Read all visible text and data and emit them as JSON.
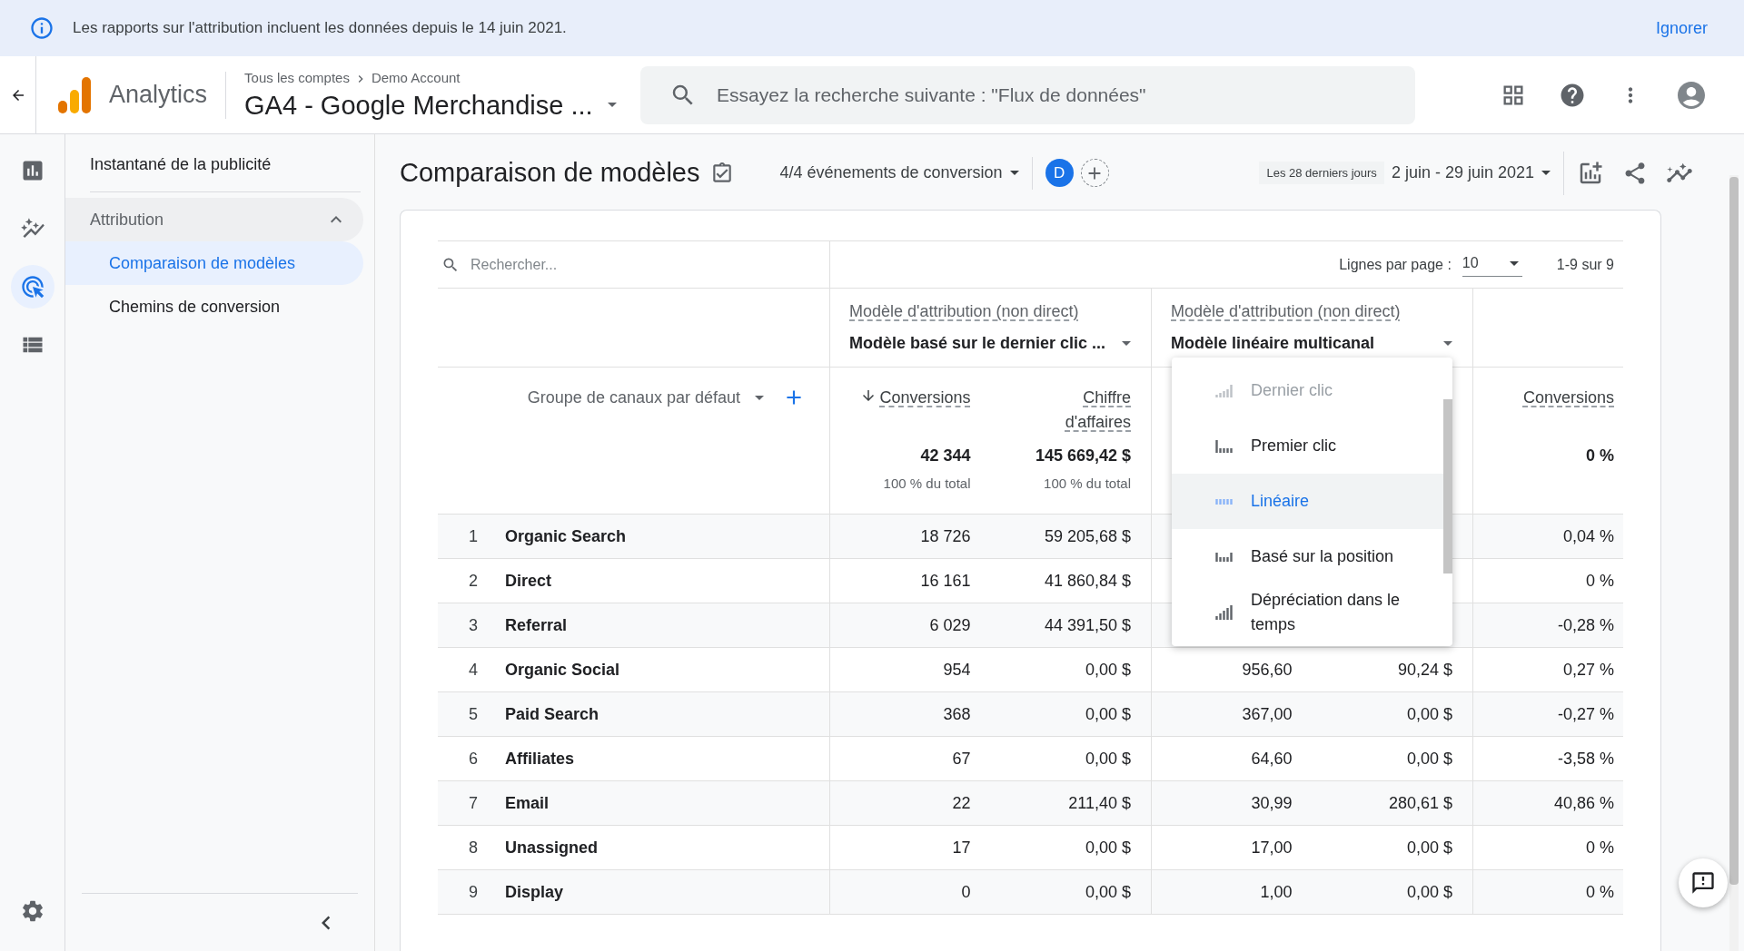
{
  "banner": {
    "message": "Les rapports sur l'attribution incluent les données depuis le 14 juin 2021.",
    "dismiss": "Ignorer"
  },
  "header": {
    "product": "Analytics",
    "breadcrumb": [
      "Tous les comptes",
      "Demo Account"
    ],
    "property": "GA4 - Google Merchandise ...",
    "search": {
      "placeholder": "Essayez la recherche suivante : \"Flux de données\""
    }
  },
  "rail": [
    {
      "selected": false
    },
    {
      "selected": false
    },
    {
      "selected": true
    },
    {
      "selected": false
    }
  ],
  "nav": {
    "title": "Instantané de la publicité",
    "section": {
      "label": "Attribution",
      "expanded": true,
      "items": [
        {
          "label": "Comparaison de modèles",
          "selected": true
        },
        {
          "label": "Chemins de conversion",
          "selected": false
        }
      ]
    }
  },
  "report": {
    "title": "Comparaison de modèles",
    "conversion_events": "4/4 événements de conversion",
    "comparison_avatar": "D",
    "date_preset": "Les 28 derniers jours",
    "date_range": "2 juin - 29 juin 2021"
  },
  "table": {
    "search_placeholder": "Rechercher...",
    "rows_per_page_label": "Lignes par page :",
    "rows_per_page": "10",
    "pagination": "1-9 sur 9",
    "dimension": "Groupe de canaux par défaut",
    "models": [
      {
        "label": "Modèle d'attribution (non direct)",
        "value": "Modèle basé sur le dernier clic ...",
        "columns": [
          {
            "label": "Conversions",
            "sorted": true
          },
          {
            "label": "Chiffre d'affaires",
            "sorted": false
          }
        ],
        "totals": [
          {
            "value": "42 344",
            "share": "100 % du total"
          },
          {
            "value": "145 669,42 $",
            "share": "100 % du total"
          }
        ]
      },
      {
        "label": "Modèle d'attribution (non direct)",
        "value": "Modèle linéaire multicanal"
      }
    ],
    "change_column": {
      "label": "Conversions",
      "total": "0 %"
    },
    "rows": [
      {
        "rank": "1",
        "channel": "Organic Search",
        "model_a": [
          "18 726",
          "59 205,68 $"
        ],
        "change": "0,04 %"
      },
      {
        "rank": "2",
        "channel": "Direct",
        "model_a": [
          "16 161",
          "41 860,84 $"
        ],
        "change": "0 %"
      },
      {
        "rank": "3",
        "channel": "Referral",
        "model_a": [
          "6 029",
          "44 391,50 $"
        ],
        "change": "-0,28 %"
      },
      {
        "rank": "4",
        "channel": "Organic Social",
        "model_a": [
          "954",
          "0,00 $"
        ],
        "model_b": [
          "956,60",
          "90,24 $"
        ],
        "change": "0,27 %"
      },
      {
        "rank": "5",
        "channel": "Paid Search",
        "model_a": [
          "368",
          "0,00 $"
        ],
        "model_b": [
          "367,00",
          "0,00 $"
        ],
        "change": "-0,27 %"
      },
      {
        "rank": "6",
        "channel": "Affiliates",
        "model_a": [
          "67",
          "0,00 $"
        ],
        "model_b": [
          "64,60",
          "0,00 $"
        ],
        "change": "-3,58 %"
      },
      {
        "rank": "7",
        "channel": "Email",
        "model_a": [
          "22",
          "211,40 $"
        ],
        "model_b": [
          "30,99",
          "280,61 $"
        ],
        "change": "40,86 %"
      },
      {
        "rank": "8",
        "channel": "Unassigned",
        "model_a": [
          "17",
          "0,00 $"
        ],
        "model_b": [
          "17,00",
          "0,00 $"
        ],
        "change": "0 %"
      },
      {
        "rank": "9",
        "channel": "Display",
        "model_a": [
          "0",
          "0,00 $"
        ],
        "model_b": [
          "1,00",
          "0,00 $"
        ],
        "change": "0 %"
      }
    ],
    "menu": {
      "items": [
        {
          "label": "Dernier clic",
          "disabled": true,
          "selected": false
        },
        {
          "label": "Premier clic",
          "disabled": false,
          "selected": false
        },
        {
          "label": "Linéaire",
          "disabled": false,
          "selected": true
        },
        {
          "label": "Basé sur la position",
          "disabled": false,
          "selected": false
        },
        {
          "label": "Dépréciation dans le temps",
          "disabled": false,
          "selected": false
        }
      ]
    }
  }
}
